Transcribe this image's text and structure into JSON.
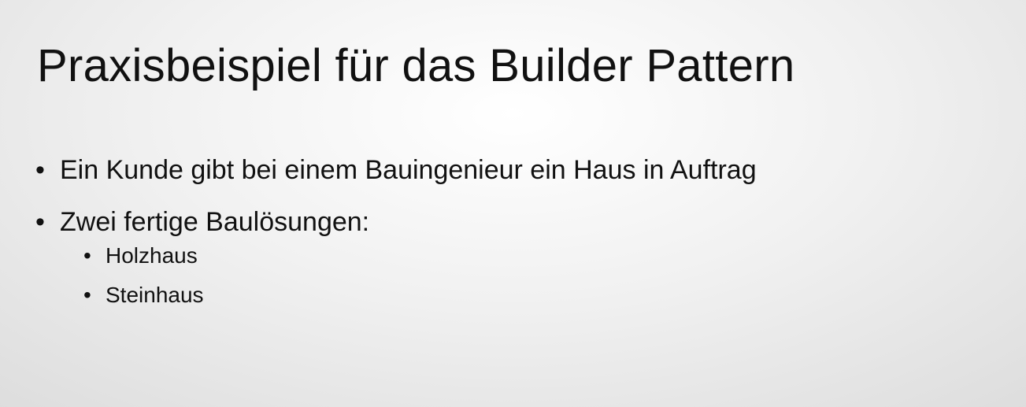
{
  "slide": {
    "title": "Praxisbeispiel für das Builder Pattern",
    "bullet_symbol": "•",
    "bullets": [
      {
        "text": "Ein Kunde gibt bei einem Bauingenieur ein Haus in Auftrag"
      },
      {
        "text": "Zwei fertige Baulösungen:",
        "sub_bullets": [
          {
            "text": "Holzhaus"
          },
          {
            "text": "Steinhaus"
          }
        ]
      }
    ]
  }
}
